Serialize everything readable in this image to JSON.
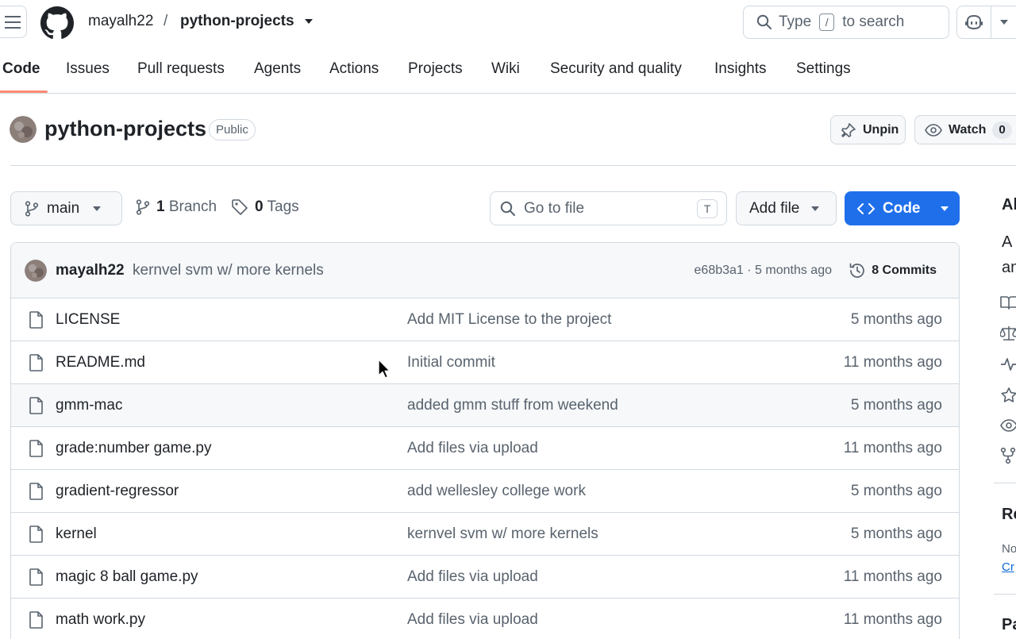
{
  "header": {
    "owner": "mayalh22",
    "separator": "/",
    "repo": "python-projects",
    "search": {
      "prefix": "Type",
      "key": "/",
      "suffix": "to search"
    }
  },
  "nav": {
    "tabs": [
      {
        "label": "Code",
        "active": true
      },
      {
        "label": "Issues"
      },
      {
        "label": "Pull requests"
      },
      {
        "label": "Agents"
      },
      {
        "label": "Actions"
      },
      {
        "label": "Projects"
      },
      {
        "label": "Wiki"
      },
      {
        "label": "Security and quality"
      },
      {
        "label": "Insights"
      },
      {
        "label": "Settings"
      }
    ]
  },
  "repo": {
    "title": "python-projects",
    "visibility": "Public",
    "unpin_label": "Unpin",
    "watch_label": "Watch",
    "watch_count": "0"
  },
  "toolbar": {
    "branch": "main",
    "branches_count": "1",
    "branches_label": "Branch",
    "tags_count": "0",
    "tags_label": "Tags",
    "goto_placeholder": "Go to file",
    "goto_key": "T",
    "add_file_label": "Add file",
    "code_label": "Code"
  },
  "latest_commit": {
    "author": "mayalh22",
    "message": "kernvel svm w/ more kernels",
    "meta": "e68b3a1 · 5 months ago",
    "commits_label": "8 Commits"
  },
  "files": [
    {
      "name": "LICENSE",
      "message": "Add MIT License to the project",
      "date": "5 months ago"
    },
    {
      "name": "README.md",
      "message": "Initial commit",
      "date": "11 months ago"
    },
    {
      "name": "gmm-mac",
      "message": "added gmm stuff from weekend",
      "date": "5 months ago"
    },
    {
      "name": "grade:number game.py",
      "message": "Add files via upload",
      "date": "11 months ago"
    },
    {
      "name": "gradient-regressor",
      "message": "add wellesley college work",
      "date": "5 months ago"
    },
    {
      "name": "kernel",
      "message": "kernvel svm w/ more kernels",
      "date": "5 months ago"
    },
    {
      "name": "magic 8 ball game.py",
      "message": "Add files via upload",
      "date": "11 months ago"
    },
    {
      "name": "math work.py",
      "message": "Add files via upload",
      "date": "11 months ago"
    }
  ],
  "sidebar": {
    "about_fragment": "Al",
    "desc_line1": "A",
    "desc_line2": "an",
    "releases_fragment": "Re",
    "releases_none": "No",
    "releases_create": "Cr",
    "packages_fragment": "Pa"
  },
  "colors": {
    "accent": "#1f6feb",
    "nav_underline": "#fd8c73",
    "muted": "#59636e",
    "border": "#d1d9e0",
    "link": "#0969da"
  }
}
